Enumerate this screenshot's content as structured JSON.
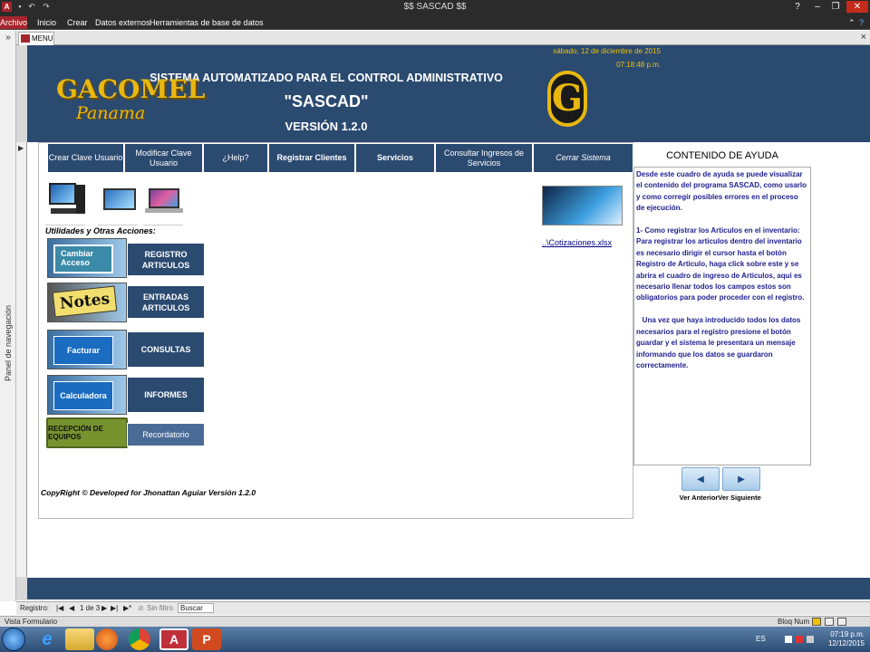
{
  "window": {
    "title": "$$ SASCAD $$"
  },
  "ribbon": {
    "tabs": [
      "Archivo",
      "Inicio",
      "Crear",
      "Datos externos",
      "Herramientas de base de datos"
    ]
  },
  "nav_pane": {
    "label": "Panel de navegación"
  },
  "document_tab": {
    "label": "MENU"
  },
  "header": {
    "date": "sábado, 12 de diciembre de 2015",
    "time": "07:18:48 p.m.",
    "line1": "SISTEMA AUTOMATIZADO PARA EL CONTROL ADMINISTRATIVO",
    "line2": "\"SASCAD\"",
    "line3": "VERSIÓN 1.2.0",
    "logo_text": "GACOMEL",
    "logo_sub": "Panama",
    "logo_g": "G"
  },
  "top_nav": [
    "Crear Clave Usuario",
    "Modificar Clave Usuario",
    "¿Help?",
    "Registrar Clientes",
    "Servicios",
    "Consultar Ingresos de Servicios",
    "Cerrar Sistema"
  ],
  "utilities_label": "Utilidades y Otras Acciones:",
  "left_buttons": {
    "cambiar": "Cambiar Acceso",
    "notes": "Notes",
    "facturar": "Facturar",
    "calculadora": "Calculadora",
    "recepcion": "RECEPCIÓN DE EQUIPOS"
  },
  "right_buttons": {
    "registro": "REGISTRO ARTICULOS",
    "entradas": "ENTRADAS ARTICULOS",
    "consultas": "CONSULTAS",
    "informes": "INFORMES",
    "recordatorio": "Recordatorio"
  },
  "cotizaciones_link": "..\\Cotizaciones.xlsx",
  "copyright": "CopyRight © Developed for Jhonattan Aguiar Versión 1.2.0",
  "help": {
    "title": "CONTENIDO DE AYUDA",
    "text": "Desde este cuadro de ayuda se puede visualizar el contenido del programa SASCAD, como usarlo y como corregir posibles errores en el proceso de ejecución.\n\n1- Como registrar los Articulos en el inventario: Para registrar los articulos dentro del inventario es necesario dirigir el cursor hasta el botón Registro de Articulo, haga click sobre este y se abrira el cuadro de ingreso de Articulos, aqui es necesario llenar todos los campos estos son obligatorios para poder proceder con el registro.\n\n   Una vez que haya introducido todos los datos necesarios para el registro presione el botón guardar y el sistema le presentara un mensaje informando que los datos se guardaron correctamente.",
    "prev_label": "Ver Anterior",
    "next_label": "Ver Siguiente"
  },
  "record_nav": {
    "label": "Registro:",
    "position": "1 de 3",
    "filter": "Sin filtro",
    "search": "Buscar"
  },
  "status": {
    "left": "Vista Formulario",
    "right": "Bloq Num"
  },
  "taskbar": {
    "lang": "ES",
    "time": "07:19 p.m.",
    "date": "12/12/2015"
  },
  "colors": {
    "header_bg": "#2b4a70",
    "accent": "#a4262c",
    "date_color": "#f0c000"
  }
}
